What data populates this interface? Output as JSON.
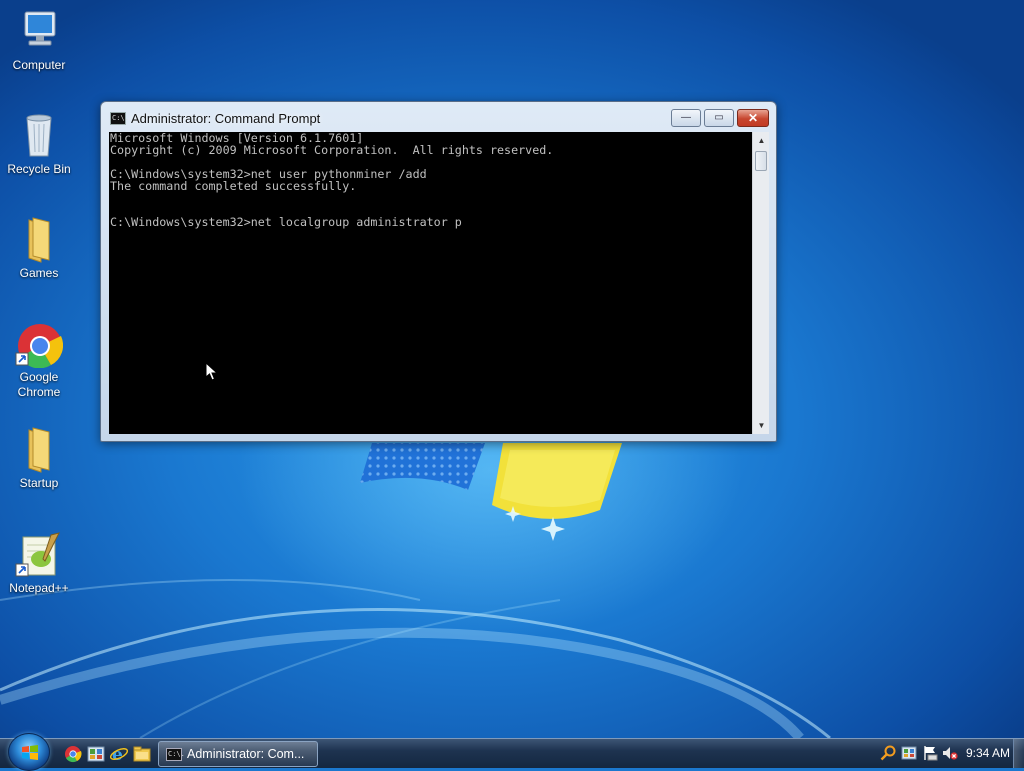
{
  "desktop": {
    "icons": [
      {
        "label": "Computer"
      },
      {
        "label": "Recycle Bin"
      },
      {
        "label": "Games"
      },
      {
        "label": "Google Chrome"
      },
      {
        "label": "Startup"
      },
      {
        "label": "Notepad++"
      }
    ]
  },
  "window": {
    "icon_text": "C:\\.",
    "title": "Administrator:  Command Prompt",
    "minimize_glyph": "—",
    "maximize_glyph": "▭",
    "close_glyph": "✕",
    "scroll_up_glyph": "▲",
    "scroll_down_glyph": "▼",
    "console_lines": [
      "Microsoft Windows [Version 6.1.7601]",
      "Copyright (c) 2009 Microsoft Corporation.  All rights reserved.",
      "",
      "C:\\Windows\\system32>net user pythonminer /add",
      "The command completed successfully.",
      "",
      "",
      "C:\\Windows\\system32>net localgroup administrator p"
    ]
  },
  "taskbar": {
    "task_icon_text": "C:\\.",
    "active_task_label": "Administrator:  Com...",
    "clock": "9:34 AM",
    "quick_launch": [
      "chrome-icon",
      "control-panel-icon",
      "internet-explorer-icon",
      "explorer-icon"
    ],
    "tray": [
      "search-icon",
      "network-icon",
      "flag-icon",
      "volume-muted-icon"
    ]
  },
  "colors": {
    "console_bg": "#000000",
    "console_fg": "#c0c0c0",
    "close_button": "#c7462f",
    "desktop_blue": "#1b78cf"
  }
}
